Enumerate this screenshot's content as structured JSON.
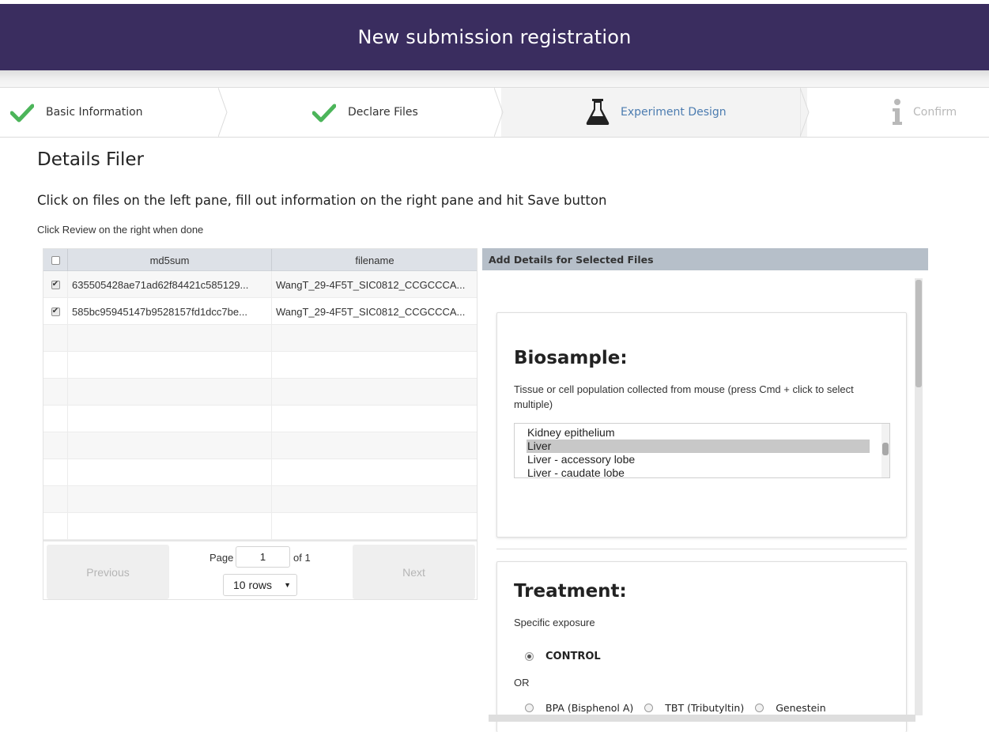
{
  "header": {
    "title": "New submission registration"
  },
  "steps": [
    {
      "label": "Basic Information",
      "icon": "check-icon",
      "state": "done"
    },
    {
      "label": "Declare Files",
      "icon": "check-icon",
      "state": "done"
    },
    {
      "label": "Experiment Design",
      "icon": "flask-icon",
      "state": "active"
    },
    {
      "label": "Confirm",
      "icon": "info-icon",
      "state": "pending"
    }
  ],
  "colors": {
    "header_bg": "#3a2d5f",
    "check": "#4cb55a",
    "active": "#4c7cb0"
  },
  "page": {
    "title": "Details Filer",
    "instructions": "Click on files on the left pane, fill out information on the right pane and hit Save button",
    "subtext": "Click Review on the right when done"
  },
  "table": {
    "columns": [
      "md5sum",
      "filename"
    ],
    "rows": [
      {
        "checked": true,
        "md5sum": "635505428ae71ad62f84421c585129...",
        "filename": "WangT_29-4F5T_SIC0812_CCGCCCA..."
      },
      {
        "checked": true,
        "md5sum": "585bc95945147b9528157fd1dcc7be...",
        "filename": "WangT_29-4F5T_SIC0812_CCGCCCA..."
      }
    ],
    "pager": {
      "previous": "Previous",
      "next": "Next",
      "page_label": "Page",
      "page_value": "1",
      "of_label": "of 1",
      "rows_option": "10 rows"
    }
  },
  "right": {
    "header": "Add Details for Selected Files",
    "biosample": {
      "title": "Biosample:",
      "hint": "Tissue or cell population collected from mouse (press Cmd + click to select multiple)",
      "options": [
        "Kidney epithelium",
        "Liver",
        "Liver - accessory lobe",
        "Liver - caudate lobe"
      ],
      "selected": "Liver"
    },
    "treatment": {
      "title": "Treatment:",
      "hint": "Specific exposure",
      "control_label": "CONTROL",
      "or_label": "OR",
      "options": [
        "BPA (Bisphenol A)",
        "TBT (Tributyltin)",
        "Genestein"
      ]
    }
  }
}
